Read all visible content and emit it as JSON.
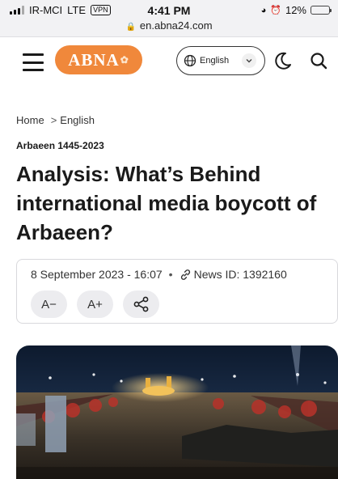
{
  "status_bar": {
    "carrier": "IR-MCI",
    "network": "LTE",
    "vpn": "VPN",
    "time": "4:41 PM",
    "battery": "12%",
    "battery_level": 0.12
  },
  "browser": {
    "url": "en.abna24.com"
  },
  "header": {
    "logo_text": "ABNA",
    "language": "English",
    "icons": [
      "menu-icon",
      "globe-icon",
      "chevron-down-icon",
      "moon-icon",
      "search-icon"
    ]
  },
  "breadcrumb": {
    "home": "Home",
    "separator": ">",
    "current": "English"
  },
  "article": {
    "category": "Arbaeen 1445-2023",
    "title": "Analysis: What’s Behind international media boycott of Arbaeen?",
    "date": "8 September 2023 - 16:07",
    "separator": "•",
    "news_id": "News ID: 1392160",
    "font_decrease": "A−",
    "font_increase": "A+"
  },
  "colors": {
    "brand": "#f0883b",
    "text": "#1a1a1a",
    "border": "#d8d8dc",
    "button_bg": "#ececef"
  }
}
